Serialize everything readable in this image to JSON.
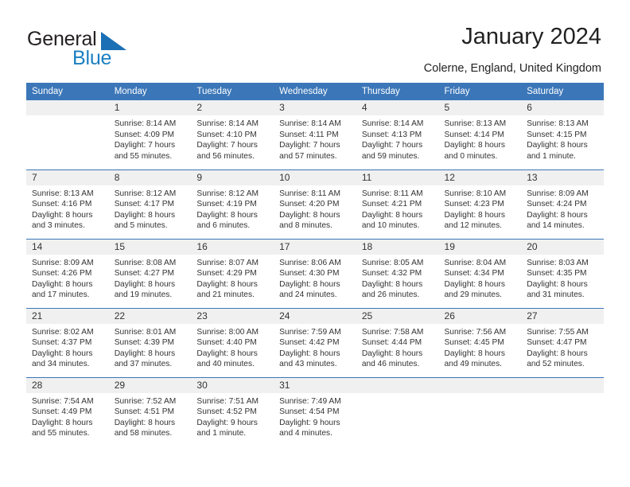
{
  "brand": {
    "name_part1": "General",
    "name_part2": "Blue",
    "color_dark": "#231f20",
    "color_blue": "#1a7fc1"
  },
  "header": {
    "title": "January 2024",
    "subtitle": "Colerne, England, United Kingdom"
  },
  "theme": {
    "header_row_bg": "#3B76B8",
    "daynum_bg": "#F0F0F0",
    "grid_line": "#3B76B8",
    "text": "#333333"
  },
  "weekdays": [
    "Sunday",
    "Monday",
    "Tuesday",
    "Wednesday",
    "Thursday",
    "Friday",
    "Saturday"
  ],
  "weeks": [
    [
      {
        "day": "",
        "sunrise": "",
        "sunset": "",
        "daylight1": "",
        "daylight2": ""
      },
      {
        "day": "1",
        "sunrise": "Sunrise: 8:14 AM",
        "sunset": "Sunset: 4:09 PM",
        "daylight1": "Daylight: 7 hours",
        "daylight2": "and 55 minutes."
      },
      {
        "day": "2",
        "sunrise": "Sunrise: 8:14 AM",
        "sunset": "Sunset: 4:10 PM",
        "daylight1": "Daylight: 7 hours",
        "daylight2": "and 56 minutes."
      },
      {
        "day": "3",
        "sunrise": "Sunrise: 8:14 AM",
        "sunset": "Sunset: 4:11 PM",
        "daylight1": "Daylight: 7 hours",
        "daylight2": "and 57 minutes."
      },
      {
        "day": "4",
        "sunrise": "Sunrise: 8:14 AM",
        "sunset": "Sunset: 4:13 PM",
        "daylight1": "Daylight: 7 hours",
        "daylight2": "and 59 minutes."
      },
      {
        "day": "5",
        "sunrise": "Sunrise: 8:13 AM",
        "sunset": "Sunset: 4:14 PM",
        "daylight1": "Daylight: 8 hours",
        "daylight2": "and 0 minutes."
      },
      {
        "day": "6",
        "sunrise": "Sunrise: 8:13 AM",
        "sunset": "Sunset: 4:15 PM",
        "daylight1": "Daylight: 8 hours",
        "daylight2": "and 1 minute."
      }
    ],
    [
      {
        "day": "7",
        "sunrise": "Sunrise: 8:13 AM",
        "sunset": "Sunset: 4:16 PM",
        "daylight1": "Daylight: 8 hours",
        "daylight2": "and 3 minutes."
      },
      {
        "day": "8",
        "sunrise": "Sunrise: 8:12 AM",
        "sunset": "Sunset: 4:17 PM",
        "daylight1": "Daylight: 8 hours",
        "daylight2": "and 5 minutes."
      },
      {
        "day": "9",
        "sunrise": "Sunrise: 8:12 AM",
        "sunset": "Sunset: 4:19 PM",
        "daylight1": "Daylight: 8 hours",
        "daylight2": "and 6 minutes."
      },
      {
        "day": "10",
        "sunrise": "Sunrise: 8:11 AM",
        "sunset": "Sunset: 4:20 PM",
        "daylight1": "Daylight: 8 hours",
        "daylight2": "and 8 minutes."
      },
      {
        "day": "11",
        "sunrise": "Sunrise: 8:11 AM",
        "sunset": "Sunset: 4:21 PM",
        "daylight1": "Daylight: 8 hours",
        "daylight2": "and 10 minutes."
      },
      {
        "day": "12",
        "sunrise": "Sunrise: 8:10 AM",
        "sunset": "Sunset: 4:23 PM",
        "daylight1": "Daylight: 8 hours",
        "daylight2": "and 12 minutes."
      },
      {
        "day": "13",
        "sunrise": "Sunrise: 8:09 AM",
        "sunset": "Sunset: 4:24 PM",
        "daylight1": "Daylight: 8 hours",
        "daylight2": "and 14 minutes."
      }
    ],
    [
      {
        "day": "14",
        "sunrise": "Sunrise: 8:09 AM",
        "sunset": "Sunset: 4:26 PM",
        "daylight1": "Daylight: 8 hours",
        "daylight2": "and 17 minutes."
      },
      {
        "day": "15",
        "sunrise": "Sunrise: 8:08 AM",
        "sunset": "Sunset: 4:27 PM",
        "daylight1": "Daylight: 8 hours",
        "daylight2": "and 19 minutes."
      },
      {
        "day": "16",
        "sunrise": "Sunrise: 8:07 AM",
        "sunset": "Sunset: 4:29 PM",
        "daylight1": "Daylight: 8 hours",
        "daylight2": "and 21 minutes."
      },
      {
        "day": "17",
        "sunrise": "Sunrise: 8:06 AM",
        "sunset": "Sunset: 4:30 PM",
        "daylight1": "Daylight: 8 hours",
        "daylight2": "and 24 minutes."
      },
      {
        "day": "18",
        "sunrise": "Sunrise: 8:05 AM",
        "sunset": "Sunset: 4:32 PM",
        "daylight1": "Daylight: 8 hours",
        "daylight2": "and 26 minutes."
      },
      {
        "day": "19",
        "sunrise": "Sunrise: 8:04 AM",
        "sunset": "Sunset: 4:34 PM",
        "daylight1": "Daylight: 8 hours",
        "daylight2": "and 29 minutes."
      },
      {
        "day": "20",
        "sunrise": "Sunrise: 8:03 AM",
        "sunset": "Sunset: 4:35 PM",
        "daylight1": "Daylight: 8 hours",
        "daylight2": "and 31 minutes."
      }
    ],
    [
      {
        "day": "21",
        "sunrise": "Sunrise: 8:02 AM",
        "sunset": "Sunset: 4:37 PM",
        "daylight1": "Daylight: 8 hours",
        "daylight2": "and 34 minutes."
      },
      {
        "day": "22",
        "sunrise": "Sunrise: 8:01 AM",
        "sunset": "Sunset: 4:39 PM",
        "daylight1": "Daylight: 8 hours",
        "daylight2": "and 37 minutes."
      },
      {
        "day": "23",
        "sunrise": "Sunrise: 8:00 AM",
        "sunset": "Sunset: 4:40 PM",
        "daylight1": "Daylight: 8 hours",
        "daylight2": "and 40 minutes."
      },
      {
        "day": "24",
        "sunrise": "Sunrise: 7:59 AM",
        "sunset": "Sunset: 4:42 PM",
        "daylight1": "Daylight: 8 hours",
        "daylight2": "and 43 minutes."
      },
      {
        "day": "25",
        "sunrise": "Sunrise: 7:58 AM",
        "sunset": "Sunset: 4:44 PM",
        "daylight1": "Daylight: 8 hours",
        "daylight2": "and 46 minutes."
      },
      {
        "day": "26",
        "sunrise": "Sunrise: 7:56 AM",
        "sunset": "Sunset: 4:45 PM",
        "daylight1": "Daylight: 8 hours",
        "daylight2": "and 49 minutes."
      },
      {
        "day": "27",
        "sunrise": "Sunrise: 7:55 AM",
        "sunset": "Sunset: 4:47 PM",
        "daylight1": "Daylight: 8 hours",
        "daylight2": "and 52 minutes."
      }
    ],
    [
      {
        "day": "28",
        "sunrise": "Sunrise: 7:54 AM",
        "sunset": "Sunset: 4:49 PM",
        "daylight1": "Daylight: 8 hours",
        "daylight2": "and 55 minutes."
      },
      {
        "day": "29",
        "sunrise": "Sunrise: 7:52 AM",
        "sunset": "Sunset: 4:51 PM",
        "daylight1": "Daylight: 8 hours",
        "daylight2": "and 58 minutes."
      },
      {
        "day": "30",
        "sunrise": "Sunrise: 7:51 AM",
        "sunset": "Sunset: 4:52 PM",
        "daylight1": "Daylight: 9 hours",
        "daylight2": "and 1 minute."
      },
      {
        "day": "31",
        "sunrise": "Sunrise: 7:49 AM",
        "sunset": "Sunset: 4:54 PM",
        "daylight1": "Daylight: 9 hours",
        "daylight2": "and 4 minutes."
      },
      {
        "day": "",
        "sunrise": "",
        "sunset": "",
        "daylight1": "",
        "daylight2": ""
      },
      {
        "day": "",
        "sunrise": "",
        "sunset": "",
        "daylight1": "",
        "daylight2": ""
      },
      {
        "day": "",
        "sunrise": "",
        "sunset": "",
        "daylight1": "",
        "daylight2": ""
      }
    ]
  ]
}
